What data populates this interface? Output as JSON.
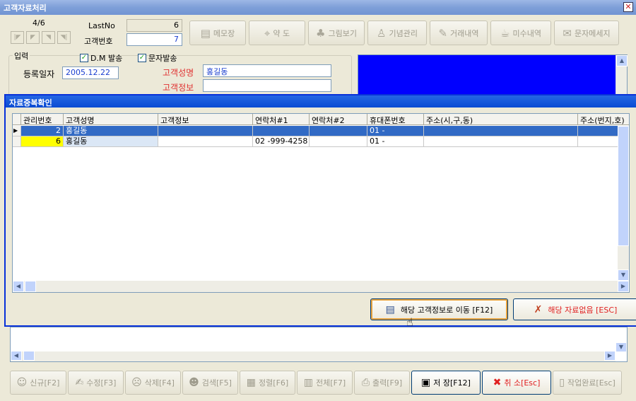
{
  "window": {
    "title": "고객자료처리",
    "close_glyph": "✕"
  },
  "record_nav": {
    "position": "4/6",
    "lastno_label": "LastNo",
    "lastno_value": "6",
    "customer_no_label": "고객번호",
    "customer_no_value": "7",
    "buttons": [
      {
        "name": "first-record-button",
        "glyph": "|◤"
      },
      {
        "name": "prev-record-button",
        "glyph": "◤"
      },
      {
        "name": "next-record-button",
        "glyph": "◥"
      },
      {
        "name": "last-record-button",
        "glyph": "◥|"
      }
    ]
  },
  "toolbar": [
    {
      "name": "memo-button",
      "label": "메모장",
      "icon": "memo-icon",
      "glyph": "▤"
    },
    {
      "name": "map-button",
      "label": "약 도",
      "icon": "map-icon",
      "glyph": "⌖"
    },
    {
      "name": "picture-button",
      "label": "그림보기",
      "icon": "picture-icon",
      "glyph": "♣"
    },
    {
      "name": "anniversary-button",
      "label": "기념관리",
      "icon": "anniversary-icon",
      "glyph": "♙"
    },
    {
      "name": "transactions-button",
      "label": "거래내역",
      "icon": "transactions-icon",
      "glyph": "✎"
    },
    {
      "name": "unpaid-button",
      "label": "미수내역",
      "icon": "unpaid-icon",
      "glyph": "☕"
    },
    {
      "name": "sms-button",
      "label": "문자메세지",
      "icon": "sms-icon",
      "glyph": "✉"
    }
  ],
  "input": {
    "group_label": "입력",
    "dm_label": "D.M 발송",
    "sms_label": "문자발송",
    "check_glyph": "✓",
    "reg_date_label": "등록일자",
    "reg_date_value": "2005.12.22",
    "name_label": "고객성명",
    "name_value": "홍길동",
    "info_label": "고객정보",
    "info_value": ""
  },
  "dialog": {
    "title": "자료중복확인",
    "columns": [
      "관리번호",
      "고객성명",
      "고객정보",
      "연락처#1",
      "연락처#2",
      "휴대폰번호",
      "주소(시,구,동)",
      "주소(번지,호)"
    ],
    "rows": [
      {
        "indicator": "▶",
        "cells": [
          "2",
          "홍길동",
          "",
          "",
          "",
          "01 -",
          "",
          ""
        ]
      },
      {
        "indicator": "",
        "cells": [
          "6",
          "홍길동",
          "",
          "02   -999-4258",
          "",
          "01 -",
          "",
          ""
        ]
      }
    ],
    "goto_button": "해당 고객정보로 이동 [F12]",
    "none_button": "해당 자료없음 [ESC]"
  },
  "bottom_toolbar": [
    {
      "name": "new-button",
      "label": "신규[F2]",
      "icon": "new-user-icon",
      "glyph": "☺"
    },
    {
      "name": "edit-button",
      "label": "수정[F3]",
      "icon": "edit-icon",
      "glyph": "✍"
    },
    {
      "name": "delete-button",
      "label": "삭제[F4]",
      "icon": "delete-user-icon",
      "glyph": "☹"
    },
    {
      "name": "search-button",
      "label": "검색[F5]",
      "icon": "search-user-icon",
      "glyph": "☻"
    },
    {
      "name": "sort-button",
      "label": "정렬[F6]",
      "icon": "sort-icon",
      "glyph": "▦"
    },
    {
      "name": "all-button",
      "label": "전체[F7]",
      "icon": "list-icon",
      "glyph": "▥"
    },
    {
      "name": "print-button",
      "label": "출력[F9]",
      "icon": "print-icon",
      "glyph": "⎙"
    },
    {
      "name": "save-button",
      "label": "저 장[F12]",
      "icon": "save-icon",
      "glyph": "▣"
    },
    {
      "name": "cancel-button",
      "label": "취 소[Esc]",
      "icon": "cancel-icon",
      "glyph": "✖"
    },
    {
      "name": "done-button",
      "label": "작업완료[Esc]",
      "icon": "door-icon",
      "glyph": "▯"
    }
  ]
}
